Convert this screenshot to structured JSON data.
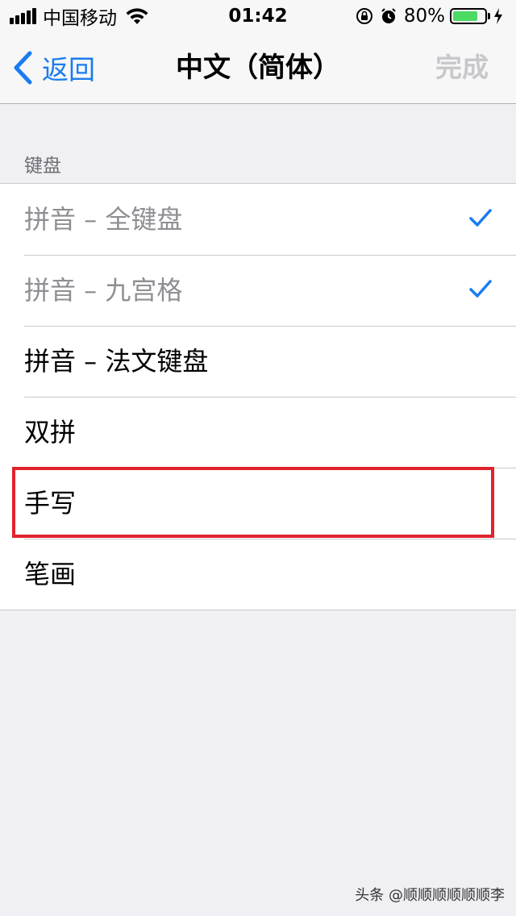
{
  "status_bar": {
    "carrier": "中国移动",
    "time": "01:42",
    "battery_percent": "80%",
    "battery_level": 0.8,
    "battery_color": "#4cd964"
  },
  "nav": {
    "back_label": "返回",
    "title": "中文（简体）",
    "done_label": "完成"
  },
  "section": {
    "header": "键盘"
  },
  "keyboards": [
    {
      "label": "拼音 – 全键盘",
      "checked": true
    },
    {
      "label": "拼音 – 九宫格",
      "checked": true
    },
    {
      "label": "拼音 – 法文键盘",
      "checked": false
    },
    {
      "label": "双拼",
      "checked": false
    },
    {
      "label": "手写",
      "checked": false
    },
    {
      "label": "笔画",
      "checked": false
    }
  ],
  "watermark": "头条 @顺顺顺顺顺顺李",
  "colors": {
    "accent": "#1a7cf0",
    "highlight": "#e0232d"
  }
}
